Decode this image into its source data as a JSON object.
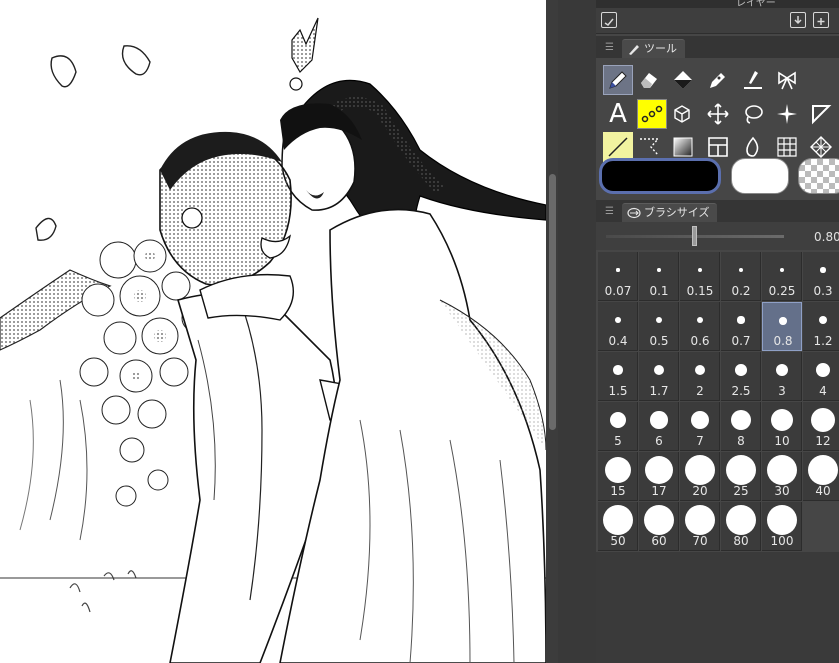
{
  "layer_panel": {
    "title": "レイヤー"
  },
  "tool_tab": {
    "label": "ツール"
  },
  "tools": [
    {
      "id": "pen",
      "icon": "pen-icon",
      "active": true
    },
    {
      "id": "eraser",
      "icon": "eraser-icon"
    },
    {
      "id": "fill",
      "icon": "fill-bucket-icon"
    },
    {
      "id": "marker",
      "icon": "marker-icon"
    },
    {
      "id": "correct-line",
      "icon": "correct-line-icon"
    },
    {
      "id": "decoration",
      "icon": "ribbon-icon"
    },
    {
      "id": "text",
      "icon": "text-icon",
      "glyph": "A"
    },
    {
      "id": "link",
      "icon": "link-chain-icon"
    },
    {
      "id": "object",
      "icon": "cube-pointer-icon"
    },
    {
      "id": "move",
      "icon": "move-arrows-icon"
    },
    {
      "id": "lasso",
      "icon": "lasso-icon"
    },
    {
      "id": "sparkle",
      "icon": "sparkle-icon"
    },
    {
      "id": "figure",
      "icon": "figure-triangle-icon"
    },
    {
      "id": "ruler",
      "icon": "ruler-line-icon"
    },
    {
      "id": "select",
      "icon": "selection-icon"
    },
    {
      "id": "gradient",
      "icon": "gradient-icon"
    },
    {
      "id": "frame",
      "icon": "frame-border-icon"
    },
    {
      "id": "blend",
      "icon": "blend-flame-icon"
    },
    {
      "id": "3d",
      "icon": "grid-cube-icon"
    },
    {
      "id": "tone",
      "icon": "tone-pattern-icon"
    }
  ],
  "colors": {
    "main": "#000000",
    "sub": "#ffffff",
    "active_tool_bg": "#6d7486",
    "highlight_tool_bg": "#ffff00"
  },
  "brush_size": {
    "tab_label": "ブラシサイズ",
    "value": "0.80",
    "slider_fraction": 0.5,
    "presets": [
      "0.07",
      "0.1",
      "0.15",
      "0.2",
      "0.25",
      "0.3",
      "0.4",
      "0.5",
      "0.6",
      "0.7",
      "0.8",
      "1.2",
      "1.5",
      "1.7",
      "2",
      "2.5",
      "3",
      "4",
      "5",
      "6",
      "7",
      "8",
      "10",
      "12",
      "15",
      "17",
      "20",
      "25",
      "30",
      "40",
      "50",
      "60",
      "70",
      "80",
      "100"
    ],
    "selected": "0.8"
  }
}
